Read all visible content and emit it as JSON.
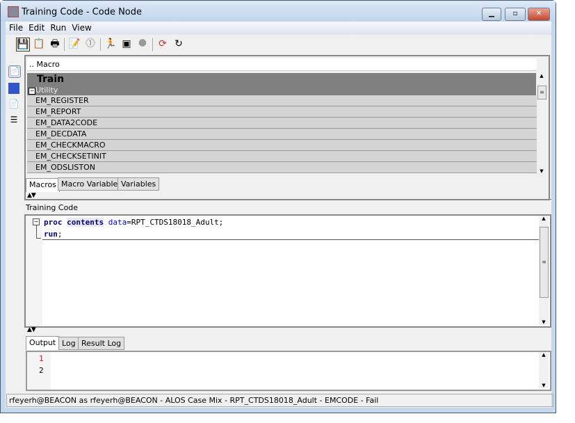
{
  "window": {
    "title": "Training Code - Code Node"
  },
  "menu": [
    "File",
    "Edit",
    "Run",
    "View"
  ],
  "toolbar": {
    "icons": [
      "save-icon",
      "copy-icon",
      "print-icon",
      "run-node-icon",
      "check-icon",
      "run-icon",
      "results-icon",
      "stop-icon",
      "refresh-icon",
      "reset-icon"
    ]
  },
  "macro_panel": {
    "header": ".. Macro",
    "group": "Train",
    "subgroup": "Utility",
    "items": [
      "EM_REGISTER",
      "EM_REPORT",
      "EM_DATA2CODE",
      "EM_DECDATA",
      "EM_CHECKMACRO",
      "EM_CHECKSETINIT",
      "EM_ODSLISTON"
    ],
    "tabs": [
      "Macros",
      "Macro Variables",
      "Variables"
    ]
  },
  "editor": {
    "label": "Training Code",
    "line1": {
      "kw1": "proc",
      "kw2": "contents",
      "opt": "data",
      "rest": "=RPT_CTDS18018_Adult;"
    },
    "line2": {
      "kw": "run",
      "rest": ";"
    }
  },
  "output": {
    "tabs": [
      "Output",
      "Log",
      "Result Log"
    ],
    "lines": [
      "1",
      "2"
    ]
  },
  "status": "rfeyerh@BEACON as rfeyerh@BEACON - ALOS Case Mix - RPT_CTDS18018_Adult - EMCODE - Fail"
}
